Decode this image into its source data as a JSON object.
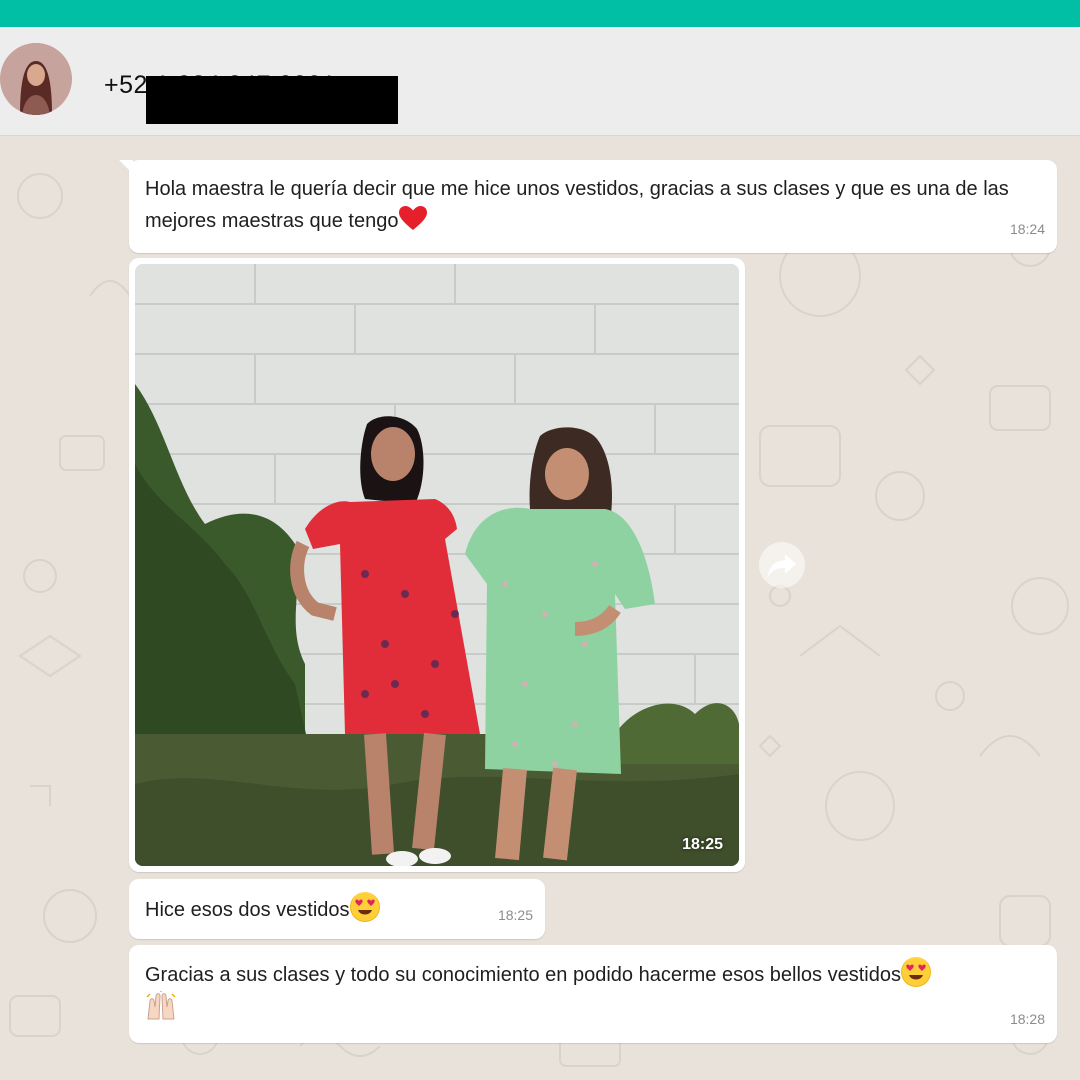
{
  "colors": {
    "accent": "#00bfa5",
    "chat_bg": "#e8e2da",
    "bubble": "#ffffff"
  },
  "header": {
    "contact_name": "+52 1 934 347 0021",
    "avatar_icon": "contact-avatar"
  },
  "messages": [
    {
      "text": "Hola maestra le quería decir que me hice unos vestidos, gracias a sus clases y que es una de las mejores maestras que tengo",
      "emoji": "red-heart",
      "time": "18:24"
    },
    {
      "type": "image",
      "time": "18:25",
      "alt_icon": "photo-two-women-dresses"
    },
    {
      "text": "Hice esos dos vestidos",
      "emoji": "smiling-face-heart-eyes",
      "time": "18:25"
    },
    {
      "text": "Gracias a sus clases y todo su conocimiento en podido hacerme esos bellos vestidos",
      "emoji": "smiling-face-heart-eyes",
      "emoji2": "raising-hands",
      "time": "18:28"
    }
  ],
  "forward": {
    "icon": "forward-arrow-icon"
  }
}
